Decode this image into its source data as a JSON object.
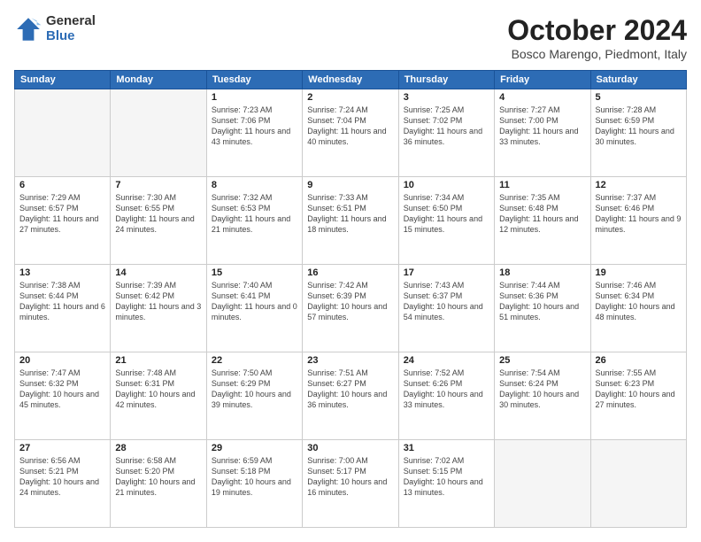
{
  "header": {
    "logo_general": "General",
    "logo_blue": "Blue",
    "month": "October 2024",
    "location": "Bosco Marengo, Piedmont, Italy"
  },
  "weekdays": [
    "Sunday",
    "Monday",
    "Tuesday",
    "Wednesday",
    "Thursday",
    "Friday",
    "Saturday"
  ],
  "weeks": [
    [
      {
        "day": "",
        "info": ""
      },
      {
        "day": "",
        "info": ""
      },
      {
        "day": "1",
        "info": "Sunrise: 7:23 AM\nSunset: 7:06 PM\nDaylight: 11 hours and 43 minutes."
      },
      {
        "day": "2",
        "info": "Sunrise: 7:24 AM\nSunset: 7:04 PM\nDaylight: 11 hours and 40 minutes."
      },
      {
        "day": "3",
        "info": "Sunrise: 7:25 AM\nSunset: 7:02 PM\nDaylight: 11 hours and 36 minutes."
      },
      {
        "day": "4",
        "info": "Sunrise: 7:27 AM\nSunset: 7:00 PM\nDaylight: 11 hours and 33 minutes."
      },
      {
        "day": "5",
        "info": "Sunrise: 7:28 AM\nSunset: 6:59 PM\nDaylight: 11 hours and 30 minutes."
      }
    ],
    [
      {
        "day": "6",
        "info": "Sunrise: 7:29 AM\nSunset: 6:57 PM\nDaylight: 11 hours and 27 minutes."
      },
      {
        "day": "7",
        "info": "Sunrise: 7:30 AM\nSunset: 6:55 PM\nDaylight: 11 hours and 24 minutes."
      },
      {
        "day": "8",
        "info": "Sunrise: 7:32 AM\nSunset: 6:53 PM\nDaylight: 11 hours and 21 minutes."
      },
      {
        "day": "9",
        "info": "Sunrise: 7:33 AM\nSunset: 6:51 PM\nDaylight: 11 hours and 18 minutes."
      },
      {
        "day": "10",
        "info": "Sunrise: 7:34 AM\nSunset: 6:50 PM\nDaylight: 11 hours and 15 minutes."
      },
      {
        "day": "11",
        "info": "Sunrise: 7:35 AM\nSunset: 6:48 PM\nDaylight: 11 hours and 12 minutes."
      },
      {
        "day": "12",
        "info": "Sunrise: 7:37 AM\nSunset: 6:46 PM\nDaylight: 11 hours and 9 minutes."
      }
    ],
    [
      {
        "day": "13",
        "info": "Sunrise: 7:38 AM\nSunset: 6:44 PM\nDaylight: 11 hours and 6 minutes."
      },
      {
        "day": "14",
        "info": "Sunrise: 7:39 AM\nSunset: 6:42 PM\nDaylight: 11 hours and 3 minutes."
      },
      {
        "day": "15",
        "info": "Sunrise: 7:40 AM\nSunset: 6:41 PM\nDaylight: 11 hours and 0 minutes."
      },
      {
        "day": "16",
        "info": "Sunrise: 7:42 AM\nSunset: 6:39 PM\nDaylight: 10 hours and 57 minutes."
      },
      {
        "day": "17",
        "info": "Sunrise: 7:43 AM\nSunset: 6:37 PM\nDaylight: 10 hours and 54 minutes."
      },
      {
        "day": "18",
        "info": "Sunrise: 7:44 AM\nSunset: 6:36 PM\nDaylight: 10 hours and 51 minutes."
      },
      {
        "day": "19",
        "info": "Sunrise: 7:46 AM\nSunset: 6:34 PM\nDaylight: 10 hours and 48 minutes."
      }
    ],
    [
      {
        "day": "20",
        "info": "Sunrise: 7:47 AM\nSunset: 6:32 PM\nDaylight: 10 hours and 45 minutes."
      },
      {
        "day": "21",
        "info": "Sunrise: 7:48 AM\nSunset: 6:31 PM\nDaylight: 10 hours and 42 minutes."
      },
      {
        "day": "22",
        "info": "Sunrise: 7:50 AM\nSunset: 6:29 PM\nDaylight: 10 hours and 39 minutes."
      },
      {
        "day": "23",
        "info": "Sunrise: 7:51 AM\nSunset: 6:27 PM\nDaylight: 10 hours and 36 minutes."
      },
      {
        "day": "24",
        "info": "Sunrise: 7:52 AM\nSunset: 6:26 PM\nDaylight: 10 hours and 33 minutes."
      },
      {
        "day": "25",
        "info": "Sunrise: 7:54 AM\nSunset: 6:24 PM\nDaylight: 10 hours and 30 minutes."
      },
      {
        "day": "26",
        "info": "Sunrise: 7:55 AM\nSunset: 6:23 PM\nDaylight: 10 hours and 27 minutes."
      }
    ],
    [
      {
        "day": "27",
        "info": "Sunrise: 6:56 AM\nSunset: 5:21 PM\nDaylight: 10 hours and 24 minutes."
      },
      {
        "day": "28",
        "info": "Sunrise: 6:58 AM\nSunset: 5:20 PM\nDaylight: 10 hours and 21 minutes."
      },
      {
        "day": "29",
        "info": "Sunrise: 6:59 AM\nSunset: 5:18 PM\nDaylight: 10 hours and 19 minutes."
      },
      {
        "day": "30",
        "info": "Sunrise: 7:00 AM\nSunset: 5:17 PM\nDaylight: 10 hours and 16 minutes."
      },
      {
        "day": "31",
        "info": "Sunrise: 7:02 AM\nSunset: 5:15 PM\nDaylight: 10 hours and 13 minutes."
      },
      {
        "day": "",
        "info": ""
      },
      {
        "day": "",
        "info": ""
      }
    ]
  ]
}
